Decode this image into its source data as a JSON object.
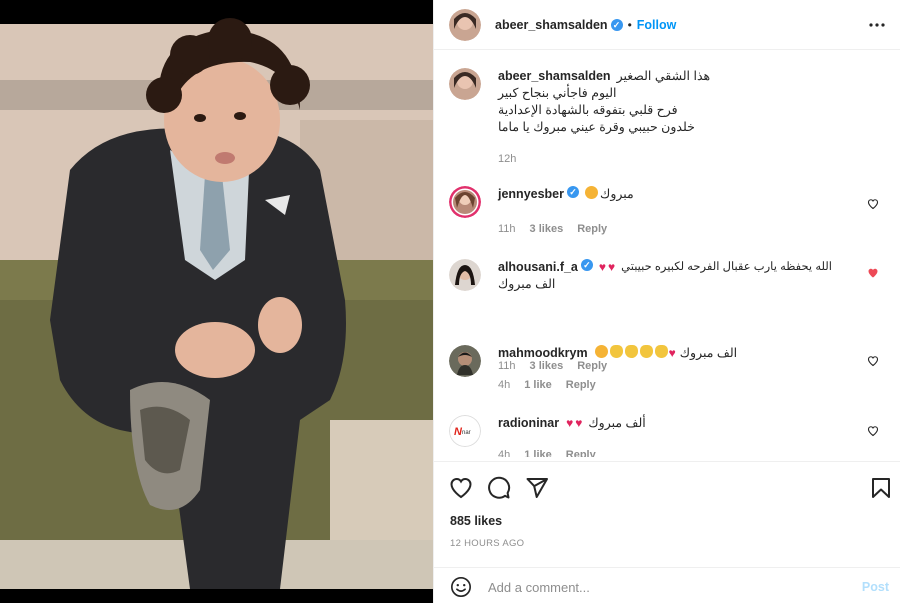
{
  "post": {
    "author": "abeer_shamsalden",
    "follow_label": "Follow",
    "separator": "•",
    "caption_lines": [
      "هذا الشقي الصغير",
      "اليوم فاجأني بنجاح كبير",
      "فرح قلبي بتفوقه بالشهادة الإعدادية",
      "خلدون حبيبي وقرة عيني مبروك يا ماما"
    ],
    "caption_time": "12h",
    "likes": "885 likes",
    "time_ago": "12 HOURS AGO"
  },
  "comments": [
    {
      "user": "jennyesber",
      "verified": true,
      "text": "مبروك",
      "time": "11h",
      "likes": "3 likes",
      "reply": "Reply"
    },
    {
      "user": "alhousani.f_a",
      "verified": true,
      "text": "الله يحفظه يارب عقبال الفرحه لكبيره حبيبتي",
      "text2": "الف مبروك",
      "time": "11h",
      "likes": "3 likes",
      "reply": "Reply"
    },
    {
      "user": "mahmoodkrym",
      "verified": false,
      "text": "الف مبروك",
      "time": "4h",
      "likes": "1 like",
      "reply": "Reply"
    },
    {
      "user": "radioninar",
      "verified": false,
      "text": "ألف مبروك",
      "time": "4h",
      "likes": "1 like",
      "reply": "Reply"
    }
  ],
  "add_comment": {
    "placeholder": "Add a comment...",
    "post_label": "Post"
  },
  "icons": {
    "more": "more-horizontal-icon",
    "like": "heart-icon",
    "comment": "comment-bubble-icon",
    "share": "paper-plane-icon",
    "save": "bookmark-icon",
    "emoji": "smiley-icon"
  },
  "colors": {
    "accent": "#0095f6",
    "verified": "#3897f0",
    "heart_red": "#ed4956",
    "post_disabled": "#b2dffc"
  }
}
